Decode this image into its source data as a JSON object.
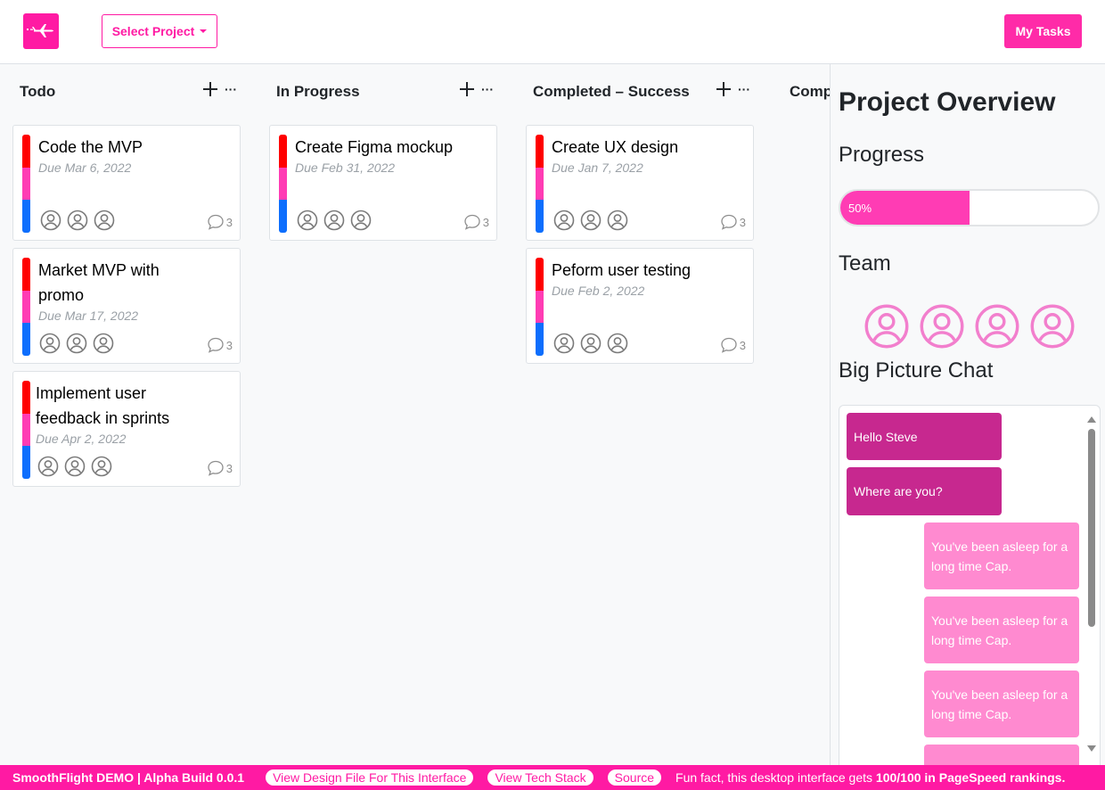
{
  "header": {
    "select_project": "Select Project",
    "my_tasks": "My Tasks"
  },
  "icons": {
    "logo": "airplane-icon",
    "add": "plus-icon",
    "more": "ellipsis-icon",
    "assignee": "user-circle-icon",
    "comment": "comment-icon"
  },
  "colors": {
    "brand": "#ff1aa3",
    "stripe": [
      "#ff0000",
      "#ff3cb4",
      "#0d6efd"
    ],
    "chat_incoming": "#c7288f",
    "chat_outgoing": "#ff8ad0"
  },
  "columns": [
    {
      "title": "Todo",
      "cards": [
        {
          "title": "Code the MVP",
          "due": "Due Mar 6, 2022",
          "comments": "3"
        },
        {
          "title": "Market MVP with promo",
          "due": "Due Mar 17, 2022",
          "comments": "3"
        },
        {
          "title": "Implement user feedback in sprints",
          "due": "Due Apr 2, 2022",
          "comments": "3"
        }
      ]
    },
    {
      "title": "In Progress",
      "cards": [
        {
          "title": "Create Figma mockup",
          "due": "Due Feb 31, 2022",
          "comments": "3"
        }
      ]
    },
    {
      "title": "Completed – Success",
      "cards": [
        {
          "title": "Create UX design",
          "due": "Due Jan 7, 2022",
          "comments": "3"
        },
        {
          "title": "Peform user testing",
          "due": "Due Feb 2, 2022",
          "comments": "3"
        }
      ]
    },
    {
      "title": "Comp",
      "cards": []
    }
  ],
  "overview": {
    "title": "Project Overview",
    "progress_heading": "Progress",
    "progress_value": 0.5,
    "progress_label": "50%",
    "team_heading": "Team",
    "team_count": 4,
    "chat_heading": "Big Picture Chat",
    "messages": [
      {
        "from": "in",
        "text": "Hello Steve"
      },
      {
        "from": "in",
        "text": "Where are you?"
      },
      {
        "from": "out",
        "text": "You've been asleep for a long time Cap."
      },
      {
        "from": "out",
        "text": "You've been asleep for a long time Cap."
      },
      {
        "from": "out",
        "text": "You've been asleep for a long time Cap."
      }
    ]
  },
  "footer": {
    "brand": "SmoothFlight DEMO | Alpha Build 0.0.1",
    "design_link": "View Design File For This Interface",
    "tech_link": "View Tech Stack",
    "source_link": "Source",
    "fact_prefix": "Fun fact, this desktop interface gets ",
    "fact_bold": "100/100 in PageSpeed rankings."
  }
}
